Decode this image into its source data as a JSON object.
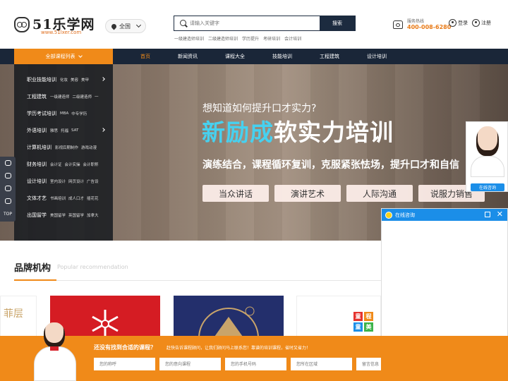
{
  "header": {
    "logo_text": "51乐学网",
    "logo_sub": "www.51lxer.com",
    "region": "全国",
    "search_placeholder": "请输入关键字",
    "search_button": "搜索",
    "hot_links": [
      "一级建造师培训",
      "二级建造师培训",
      "学历提升",
      "考研培训",
      "会计培训"
    ],
    "hotline_label": "服务热线",
    "hotline_number": "400-008-6280",
    "login": "登录",
    "register": "注册"
  },
  "nav": {
    "all_courses": "全部课程列表",
    "items": [
      "首页",
      "新闻资讯",
      "课程大全",
      "技能培训",
      "工程建筑",
      "设计培训"
    ]
  },
  "categories": [
    {
      "name": "职业技能培训",
      "subs": [
        "化妆",
        "美容",
        "美甲"
      ]
    },
    {
      "name": "工程建筑",
      "subs": [
        "一级建造师",
        "二级建造师",
        "一"
      ]
    },
    {
      "name": "学历考试培训",
      "subs": [
        "MBA",
        "中专学历"
      ]
    },
    {
      "name": "外语培训",
      "subs": [
        "雅思",
        "托福",
        "SAT"
      ]
    },
    {
      "name": "计算机培训",
      "subs": [
        "影视后期制作",
        "游戏动漫"
      ]
    },
    {
      "name": "财务培训",
      "subs": [
        "会计证",
        "会计实操",
        "会计职称"
      ]
    },
    {
      "name": "设计培训",
      "subs": [
        "室内设计",
        "网页设计",
        "广告设"
      ]
    },
    {
      "name": "文体才艺",
      "subs": [
        "书画培训",
        "成人口才",
        "插花花"
      ]
    },
    {
      "name": "出国留学",
      "subs": [
        "美国留学",
        "英国留学",
        "加拿大"
      ]
    }
  ],
  "banner": {
    "question": "想知道如何提升口才实力?",
    "title_cyan": "新励成",
    "title_white": "软实力培训",
    "tagline": "演练结合，课程循环复训，克服紧张怯场，提升口才和自信",
    "pills": [
      "当众讲话",
      "演讲艺术",
      "人际沟通",
      "说服力销售"
    ]
  },
  "side_tools": [
    "",
    "",
    "",
    "",
    "TOP"
  ],
  "brand": {
    "title": "品牌机构",
    "subtitle": "Popular recommendation",
    "card1_text": "菲层",
    "tiles": [
      "童",
      "程",
      "童",
      "美"
    ],
    "tile_colors": [
      "#e5322d",
      "#f08a19",
      "#1b8ee8",
      "#3cb44b"
    ]
  },
  "consult": {
    "button": "在线咨询",
    "chat_title": "在线咨询",
    "close": "✕"
  },
  "bottom_bar": {
    "title": "还没有找到合适的课程？",
    "subtitle": "赶快告诉课程顾问，让我们顾问马上联系您！靠谱的培训课程，省时又省力！",
    "inputs": [
      "您的称呼",
      "您的意向课程",
      "您的手机号码",
      "您所在区域",
      "留言信息"
    ]
  }
}
